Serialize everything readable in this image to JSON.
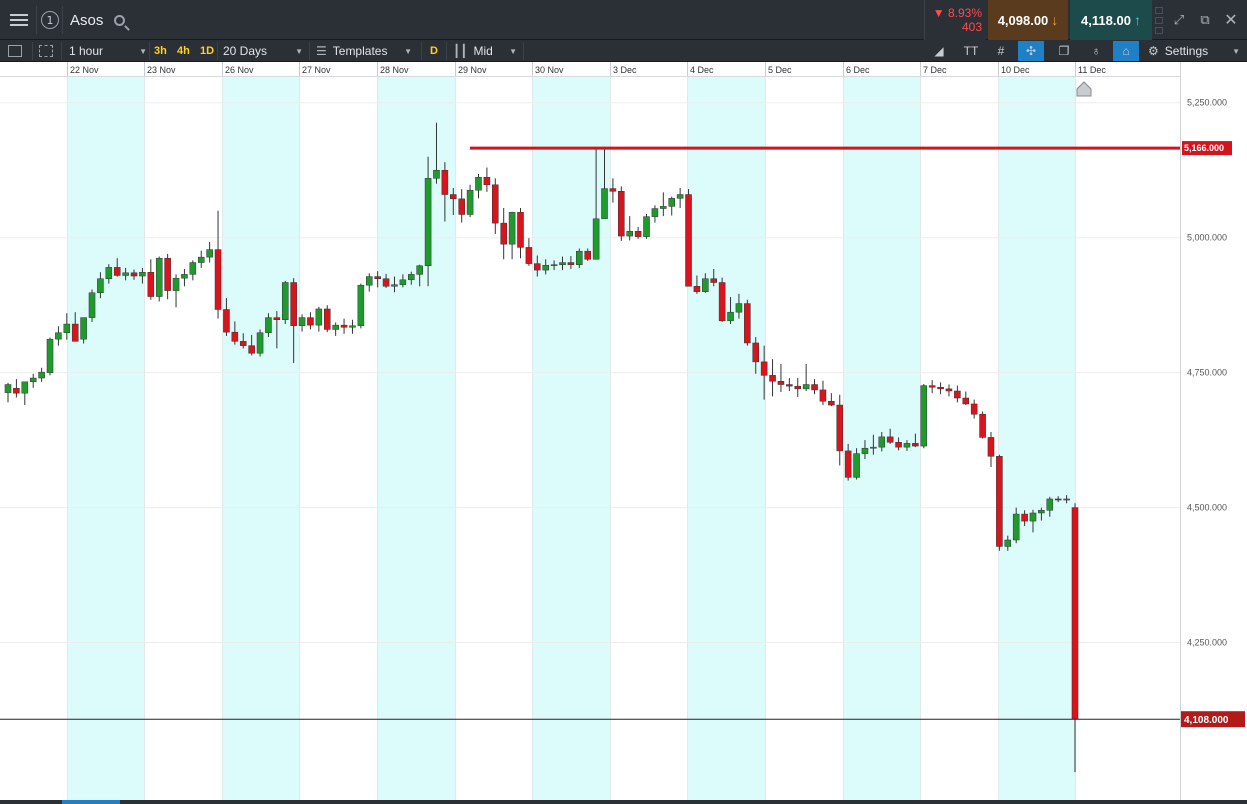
{
  "topbar": {
    "instrument": "Asos",
    "info_badge": "1",
    "change_pct": "▼ 8.93%",
    "change_pts": "403",
    "sell_price": "4,098.00",
    "buy_price": "4,118.00"
  },
  "toolbar": {
    "interval": "1 hour",
    "quick_3h": "3h",
    "quick_4h": "4h",
    "quick_1d": "1D",
    "range": "20 Days",
    "templates": "Templates",
    "d_tag": "D",
    "price_type": "Mid",
    "settings": "Settings"
  },
  "colors": {
    "up": "#1f9b2e",
    "down": "#d9141c",
    "shade": "#dcfbfb",
    "resistance": "#d4141c",
    "current": "#b31b1b"
  },
  "chart_data": {
    "type": "candlestick",
    "interval": "1 hour",
    "dates": [
      "22 Nov",
      "23 Nov",
      "26 Nov",
      "27 Nov",
      "28 Nov",
      "29 Nov",
      "30 Nov",
      "3 Dec",
      "4 Dec",
      "5 Dec",
      "6 Dec",
      "7 Dec",
      "10 Dec",
      "11 Dec"
    ],
    "price_ticks": [
      "5,250.000",
      "5,000.000",
      "4,750.000",
      "4,500.000",
      "4,250.000"
    ],
    "resistance_label": "5,166.000",
    "resistance_value": 5166,
    "current_label": "4,108.000",
    "current_value": 4108,
    "ylim": [
      3965,
      5340
    ],
    "candles": [
      [
        4713,
        4731,
        4695,
        4728
      ],
      [
        4721,
        4738,
        4704,
        4712
      ],
      [
        4712,
        4730,
        4690,
        4733
      ],
      [
        4733,
        4748,
        4722,
        4740
      ],
      [
        4740,
        4759,
        4733,
        4751
      ],
      [
        4750,
        4815,
        4745,
        4812
      ],
      [
        4812,
        4836,
        4800,
        4824
      ],
      [
        4824,
        4860,
        4811,
        4840
      ],
      [
        4840,
        4862,
        4820,
        4808
      ],
      [
        4812,
        4846,
        4804,
        4852
      ],
      [
        4852,
        4904,
        4844,
        4898
      ],
      [
        4898,
        4936,
        4888,
        4924
      ],
      [
        4924,
        4951,
        4915,
        4945
      ],
      [
        4945,
        4962,
        4928,
        4930
      ],
      [
        4930,
        4944,
        4921,
        4935
      ],
      [
        4935,
        4941,
        4922,
        4929
      ],
      [
        4929,
        4944,
        4915,
        4936
      ],
      [
        4936,
        4960,
        4885,
        4891
      ],
      [
        4891,
        4965,
        4882,
        4962
      ],
      [
        4962,
        4970,
        4886,
        4902
      ],
      [
        4902,
        4932,
        4871,
        4925
      ],
      [
        4925,
        4942,
        4910,
        4932
      ],
      [
        4932,
        4958,
        4921,
        4954
      ],
      [
        4954,
        4976,
        4944,
        4964
      ],
      [
        4964,
        4992,
        4954,
        4978
      ],
      [
        4978,
        5050,
        4850,
        4867
      ],
      [
        4867,
        4888,
        4818,
        4825
      ],
      [
        4825,
        4845,
        4802,
        4808
      ],
      [
        4808,
        4823,
        4795,
        4800
      ],
      [
        4800,
        4820,
        4782,
        4786
      ],
      [
        4786,
        4830,
        4780,
        4824
      ],
      [
        4824,
        4860,
        4816,
        4852
      ],
      [
        4852,
        4864,
        4795,
        4848
      ],
      [
        4848,
        4920,
        4840,
        4917
      ],
      [
        4917,
        4925,
        4768,
        4837
      ],
      [
        4837,
        4858,
        4826,
        4852
      ],
      [
        4852,
        4862,
        4830,
        4838
      ],
      [
        4838,
        4872,
        4826,
        4868
      ],
      [
        4868,
        4875,
        4825,
        4830
      ],
      [
        4830,
        4843,
        4818,
        4838
      ],
      [
        4838,
        4850,
        4822,
        4834
      ],
      [
        4834,
        4848,
        4822,
        4837
      ],
      [
        4837,
        4915,
        4832,
        4912
      ],
      [
        4912,
        4934,
        4900,
        4928
      ],
      [
        4928,
        4938,
        4908,
        4924
      ],
      [
        4924,
        4933,
        4907,
        4910
      ],
      [
        4910,
        4928,
        4899,
        4913
      ],
      [
        4913,
        4932,
        4908,
        4922
      ],
      [
        4922,
        4937,
        4913,
        4932
      ],
      [
        4932,
        4950,
        4910,
        4948
      ],
      [
        4948,
        5150,
        4910,
        5110
      ],
      [
        5110,
        5213,
        5100,
        5125
      ],
      [
        5125,
        5140,
        5030,
        5080
      ],
      [
        5080,
        5092,
        5042,
        5072
      ],
      [
        5072,
        5090,
        5028,
        5043
      ],
      [
        5043,
        5098,
        5038,
        5088
      ],
      [
        5088,
        5118,
        5073,
        5112
      ],
      [
        5112,
        5130,
        5085,
        5098
      ],
      [
        5098,
        5110,
        5007,
        5027
      ],
      [
        5027,
        5055,
        4960,
        4988
      ],
      [
        4988,
        5048,
        4960,
        5047
      ],
      [
        5047,
        5055,
        4962,
        4982
      ],
      [
        4982,
        4999,
        4948,
        4952
      ],
      [
        4952,
        4967,
        4928,
        4940
      ],
      [
        4940,
        4960,
        4932,
        4949
      ],
      [
        4949,
        4958,
        4940,
        4950
      ],
      [
        4950,
        4965,
        4940,
        4954
      ],
      [
        4954,
        4966,
        4942,
        4950
      ],
      [
        4950,
        4980,
        4944,
        4975
      ],
      [
        4975,
        4980,
        4957,
        4960
      ],
      [
        4960,
        5166,
        4960,
        5035
      ],
      [
        5035,
        5166,
        5072,
        5091
      ],
      [
        5091,
        5110,
        5065,
        5086
      ],
      [
        5086,
        5095,
        4994,
        5003
      ],
      [
        5003,
        5040,
        4995,
        5012
      ],
      [
        5012,
        5020,
        4998,
        5002
      ],
      [
        5002,
        5044,
        4998,
        5039
      ],
      [
        5039,
        5060,
        5028,
        5054
      ],
      [
        5054,
        5084,
        5040,
        5058
      ],
      [
        5058,
        5076,
        5041,
        5073
      ],
      [
        5073,
        5092,
        5055,
        5080
      ],
      [
        5080,
        5090,
        4988,
        4910
      ],
      [
        4910,
        4930,
        4896,
        4900
      ],
      [
        4900,
        4934,
        4898,
        4924
      ],
      [
        4924,
        4942,
        4910,
        4917
      ],
      [
        4917,
        4926,
        4844,
        4846
      ],
      [
        4846,
        4890,
        4840,
        4862
      ],
      [
        4862,
        4896,
        4850,
        4878
      ],
      [
        4878,
        4885,
        4800,
        4805
      ],
      [
        4805,
        4816,
        4748,
        4770
      ],
      [
        4770,
        4800,
        4700,
        4745
      ],
      [
        4745,
        4775,
        4706,
        4734
      ],
      [
        4734,
        4766,
        4714,
        4728
      ],
      [
        4728,
        4740,
        4716,
        4725
      ],
      [
        4725,
        4740,
        4705,
        4720
      ],
      [
        4720,
        4766,
        4716,
        4728
      ],
      [
        4728,
        4738,
        4710,
        4718
      ],
      [
        4718,
        4735,
        4690,
        4697
      ],
      [
        4697,
        4712,
        4688,
        4690
      ],
      [
        4690,
        4709,
        4578,
        4605
      ],
      [
        4605,
        4618,
        4550,
        4556
      ],
      [
        4556,
        4610,
        4552,
        4600
      ],
      [
        4600,
        4625,
        4590,
        4610
      ],
      [
        4610,
        4635,
        4598,
        4612
      ],
      [
        4612,
        4640,
        4604,
        4631
      ],
      [
        4631,
        4646,
        4618,
        4621
      ],
      [
        4621,
        4630,
        4606,
        4612
      ],
      [
        4612,
        4625,
        4605,
        4619
      ],
      [
        4619,
        4637,
        4612,
        4614
      ],
      [
        4614,
        4729,
        4610,
        4726
      ],
      [
        4726,
        4736,
        4712,
        4723
      ],
      [
        4723,
        4732,
        4710,
        4720
      ],
      [
        4720,
        4728,
        4706,
        4716
      ],
      [
        4716,
        4726,
        4695,
        4703
      ],
      [
        4703,
        4715,
        4690,
        4692
      ],
      [
        4692,
        4700,
        4665,
        4673
      ],
      [
        4673,
        4678,
        4628,
        4630
      ],
      [
        4630,
        4640,
        4575,
        4595
      ],
      [
        4595,
        4598,
        4420,
        4428
      ],
      [
        4428,
        4448,
        4420,
        4440
      ],
      [
        4440,
        4500,
        4434,
        4488
      ],
      [
        4488,
        4495,
        4466,
        4475
      ],
      [
        4475,
        4496,
        4454,
        4490
      ],
      [
        4490,
        4500,
        4476,
        4495
      ],
      [
        4495,
        4520,
        4483,
        4516
      ],
      [
        4516,
        4521,
        4510,
        4514
      ],
      [
        4514,
        4523,
        4508,
        4516
      ],
      [
        4500,
        4508,
        4010,
        4108
      ]
    ]
  }
}
